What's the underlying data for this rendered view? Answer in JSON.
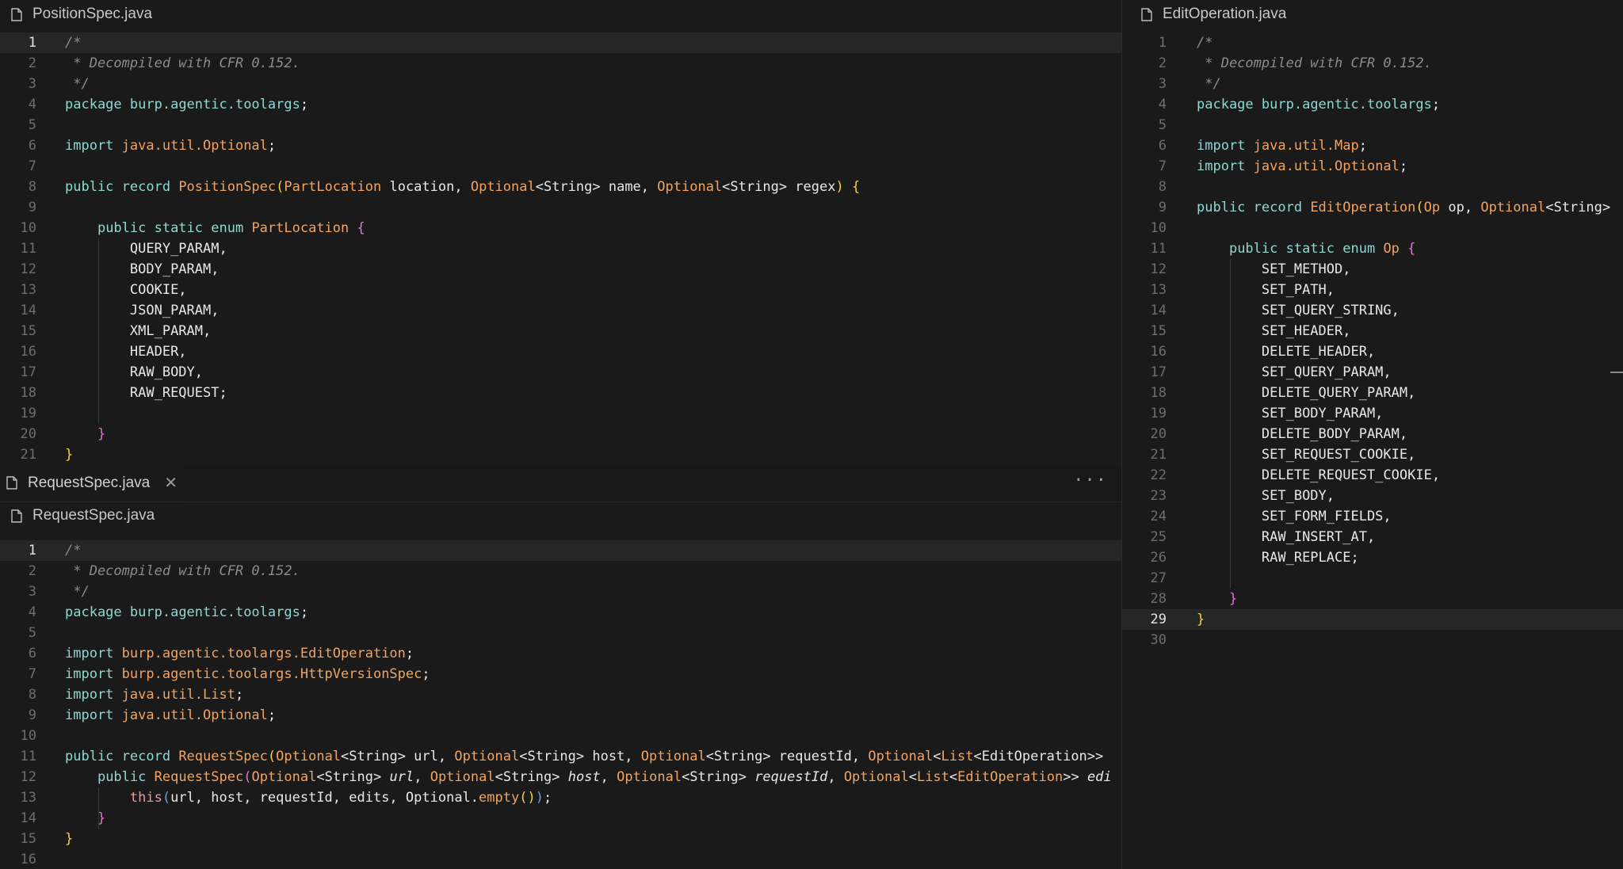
{
  "editor_groups": {
    "left_top": {
      "file_header": "PositionSpec.java",
      "active_line": "1",
      "lines": [
        {
          "n": "1",
          "html": "<span class='c'>/*</span>"
        },
        {
          "n": "2",
          "html": "<span class='c'> * Decompiled with CFR 0.152.</span>"
        },
        {
          "n": "3",
          "html": "<span class='c'> */</span>"
        },
        {
          "n": "4",
          "html": "<span class='k'>package</span> <span class='k'>burp.agentic.toolargs</span><span class='p'>;</span>"
        },
        {
          "n": "5",
          "html": ""
        },
        {
          "n": "6",
          "html": "<span class='k'>import</span> <span class='t'>java.util.Optional</span><span class='p'>;</span>"
        },
        {
          "n": "7",
          "html": ""
        },
        {
          "n": "8",
          "html": "<span class='k'>public record</span> <span class='t'>PositionSpec</span><span class='b1'>(</span><span class='t'>PartLocation</span> <span class='p'>location,</span> <span class='t'>Optional</span><span class='p'>&lt;String&gt; name,</span> <span class='t'>Optional</span><span class='p'>&lt;String&gt; regex</span><span class='b1'>)</span> <span class='b1'>{</span>"
        },
        {
          "n": "9",
          "html": ""
        },
        {
          "n": "10",
          "html": "    <span class='k'>public static enum</span> <span class='t'>PartLocation</span> <span class='b2'>{</span>"
        },
        {
          "n": "11",
          "html": "        <span class='p'>QUERY_PARAM,</span>"
        },
        {
          "n": "12",
          "html": "        <span class='p'>BODY_PARAM,</span>"
        },
        {
          "n": "13",
          "html": "        <span class='p'>COOKIE,</span>"
        },
        {
          "n": "14",
          "html": "        <span class='p'>JSON_PARAM,</span>"
        },
        {
          "n": "15",
          "html": "        <span class='p'>XML_PARAM,</span>"
        },
        {
          "n": "16",
          "html": "        <span class='p'>HEADER,</span>"
        },
        {
          "n": "17",
          "html": "        <span class='p'>RAW_BODY,</span>"
        },
        {
          "n": "18",
          "html": "        <span class='p'>RAW_REQUEST;</span>"
        },
        {
          "n": "19",
          "html": ""
        },
        {
          "n": "20",
          "html": "    <span class='b2'>}</span>"
        },
        {
          "n": "21",
          "html": "<span class='b1'>}</span>"
        }
      ]
    },
    "left_bottom": {
      "tab_label": "RequestSpec.java",
      "file_header": "RequestSpec.java",
      "active_line": "1",
      "lines": [
        {
          "n": "1",
          "html": "<span class='c'>/*</span>"
        },
        {
          "n": "2",
          "html": "<span class='c'> * Decompiled with CFR 0.152.</span>"
        },
        {
          "n": "3",
          "html": "<span class='c'> */</span>"
        },
        {
          "n": "4",
          "html": "<span class='k'>package</span> <span class='k'>burp.agentic.toolargs</span><span class='p'>;</span>"
        },
        {
          "n": "5",
          "html": ""
        },
        {
          "n": "6",
          "html": "<span class='k'>import</span> <span class='t'>burp.agentic.toolargs.EditOperation</span><span class='p'>;</span>"
        },
        {
          "n": "7",
          "html": "<span class='k'>import</span> <span class='t'>burp.agentic.toolargs.HttpVersionSpec</span><span class='p'>;</span>"
        },
        {
          "n": "8",
          "html": "<span class='k'>import</span> <span class='t'>java.util.List</span><span class='p'>;</span>"
        },
        {
          "n": "9",
          "html": "<span class='k'>import</span> <span class='t'>java.util.Optional</span><span class='p'>;</span>"
        },
        {
          "n": "10",
          "html": ""
        },
        {
          "n": "11",
          "html": "<span class='k'>public record</span> <span class='t'>RequestSpec</span><span class='b1'>(</span><span class='t'>Optional</span><span class='p'>&lt;String&gt; url,</span> <span class='t'>Optional</span><span class='p'>&lt;String&gt; host,</span> <span class='t'>Optional</span><span class='p'>&lt;String&gt; requestId,</span> <span class='t'>Optional</span><span class='p'>&lt;</span><span class='t'>List</span><span class='p'>&lt;EditOperation&gt;&gt;</span>"
        },
        {
          "n": "12",
          "html": "    <span class='k'>public</span> <span class='t'>RequestSpec</span><span class='b2'>(</span><span class='t'>Optional</span><span class='p'>&lt;String&gt; <span class='it'>url</span>,</span> <span class='t'>Optional</span><span class='p'>&lt;String&gt; <span class='it'>host</span>,</span> <span class='t'>Optional</span><span class='p'>&lt;String&gt; <span class='it'>requestId</span>,</span> <span class='t'>Optional</span><span class='p'>&lt;</span><span class='t'>List</span><span class='p'>&lt;</span><span class='t'>EditOperation</span><span class='p'>&gt;&gt; <span class='it'>edi</span></span>"
        },
        {
          "n": "13",
          "html": "        <span class='kp'>this</span><span class='b3'>(</span><span class='p'>url, host, requestId, edits, Optional.</span><span class='t'>empty</span><span class='b1'>()</span><span class='b3'>)</span><span class='p'>;</span>"
        },
        {
          "n": "14",
          "html": "    <span class='b2'>}</span>"
        },
        {
          "n": "15",
          "html": "<span class='b1'>}</span>"
        },
        {
          "n": "16",
          "html": ""
        }
      ]
    },
    "right": {
      "file_header": "EditOperation.java",
      "active_line": "29",
      "lines": [
        {
          "n": "1",
          "html": "<span class='c'>/*</span>"
        },
        {
          "n": "2",
          "html": "<span class='c'> * Decompiled with CFR 0.152.</span>"
        },
        {
          "n": "3",
          "html": "<span class='c'> */</span>"
        },
        {
          "n": "4",
          "html": "<span class='k'>package</span> <span class='k'>burp.agentic.toolargs</span><span class='p'>;</span>"
        },
        {
          "n": "5",
          "html": ""
        },
        {
          "n": "6",
          "html": "<span class='k'>import</span> <span class='t'>java.util.Map</span><span class='p'>;</span>"
        },
        {
          "n": "7",
          "html": "<span class='k'>import</span> <span class='t'>java.util.Optional</span><span class='p'>;</span>"
        },
        {
          "n": "8",
          "html": ""
        },
        {
          "n": "9",
          "html": "<span class='k'>public record</span> <span class='t'>EditOperation</span><span class='b1'>(</span><span class='t'>Op</span> <span class='p'>op,</span> <span class='t'>Optional</span><span class='p'>&lt;String&gt;</span>"
        },
        {
          "n": "10",
          "html": ""
        },
        {
          "n": "11",
          "html": "    <span class='k'>public static enum</span> <span class='t'>Op</span> <span class='b2'>{</span>"
        },
        {
          "n": "12",
          "html": "        <span class='p'>SET_METHOD,</span>"
        },
        {
          "n": "13",
          "html": "        <span class='p'>SET_PATH,</span>"
        },
        {
          "n": "14",
          "html": "        <span class='p'>SET_QUERY_STRING,</span>"
        },
        {
          "n": "15",
          "html": "        <span class='p'>SET_HEADER,</span>"
        },
        {
          "n": "16",
          "html": "        <span class='p'>DELETE_HEADER,</span>"
        },
        {
          "n": "17",
          "html": "        <span class='p'>SET_QUERY_PARAM,</span>"
        },
        {
          "n": "18",
          "html": "        <span class='p'>DELETE_QUERY_PARAM,</span>"
        },
        {
          "n": "19",
          "html": "        <span class='p'>SET_BODY_PARAM,</span>"
        },
        {
          "n": "20",
          "html": "        <span class='p'>DELETE_BODY_PARAM,</span>"
        },
        {
          "n": "21",
          "html": "        <span class='p'>SET_REQUEST_COOKIE,</span>"
        },
        {
          "n": "22",
          "html": "        <span class='p'>DELETE_REQUEST_COOKIE,</span>"
        },
        {
          "n": "23",
          "html": "        <span class='p'>SET_BODY,</span>"
        },
        {
          "n": "24",
          "html": "        <span class='p'>SET_FORM_FIELDS,</span>"
        },
        {
          "n": "25",
          "html": "        <span class='p'>RAW_INSERT_AT,</span>"
        },
        {
          "n": "26",
          "html": "        <span class='p'>RAW_REPLACE;</span>"
        },
        {
          "n": "27",
          "html": ""
        },
        {
          "n": "28",
          "html": "    <span class='b2'>}</span>"
        },
        {
          "n": "29",
          "html": "<span class='b1'>}</span>"
        },
        {
          "n": "30",
          "html": ""
        }
      ]
    }
  },
  "icons": {
    "file": "file-icon",
    "close": "close-icon",
    "more": "more-actions-icon"
  },
  "colors": {
    "background": "#1a1a1a",
    "keyword": "#8fd8d2",
    "type": "#f2a45f",
    "comment": "#8c8c8c",
    "bracket1": "#f7d04b",
    "bracket2": "#e073d3",
    "bracket3": "#5aa2f2"
  }
}
